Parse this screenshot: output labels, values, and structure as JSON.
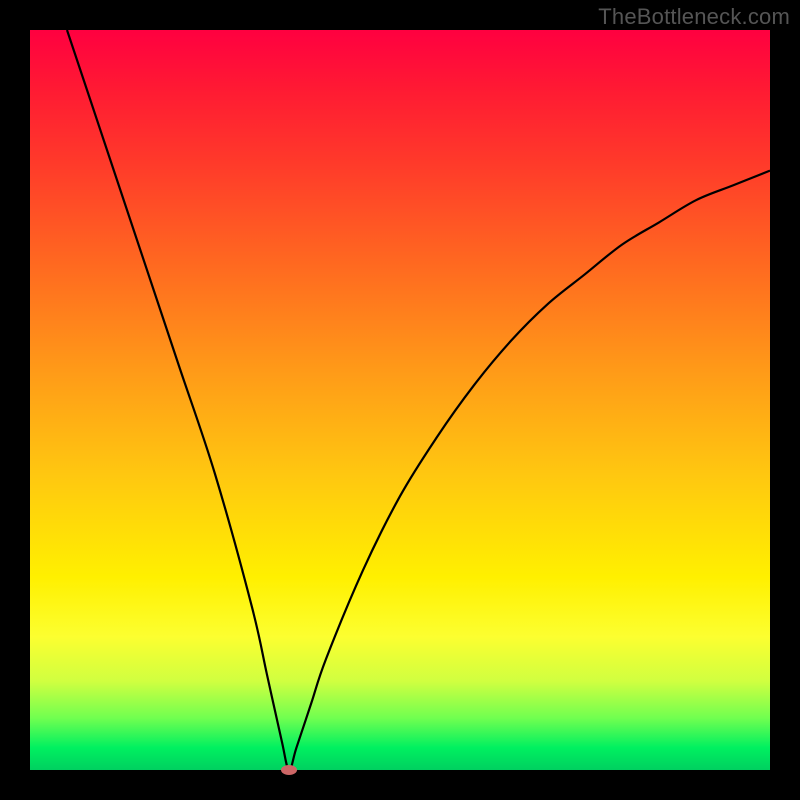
{
  "watermark": "TheBottleneck.com",
  "chart_data": {
    "type": "line",
    "title": "",
    "xlabel": "",
    "ylabel": "",
    "xlim": [
      0,
      100
    ],
    "ylim": [
      0,
      100
    ],
    "grid": false,
    "legend": false,
    "series": [
      {
        "name": "bottleneck-curve",
        "x": [
          5,
          10,
          15,
          20,
          25,
          30,
          32,
          34,
          35,
          36,
          38,
          40,
          45,
          50,
          55,
          60,
          65,
          70,
          75,
          80,
          85,
          90,
          95,
          100
        ],
        "values": [
          100,
          85,
          70,
          55,
          40,
          22,
          13,
          4,
          0,
          3,
          9,
          15,
          27,
          37,
          45,
          52,
          58,
          63,
          67,
          71,
          74,
          77,
          79,
          81
        ]
      }
    ],
    "annotations": [
      {
        "kind": "min-marker",
        "x": 35,
        "y": 0,
        "color": "#cc6666"
      }
    ],
    "background_gradient": {
      "top": "#ff0040",
      "mid": "#fff000",
      "bottom": "#00d060"
    }
  }
}
